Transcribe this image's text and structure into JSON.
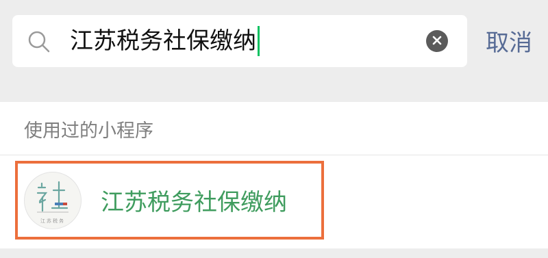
{
  "search": {
    "query": "江苏税务社保缴纳",
    "cancel_label": "取消"
  },
  "section": {
    "header": "使用过的小程序"
  },
  "results": [
    {
      "title": "江苏税务社保缴纳",
      "logo_text": "江苏税务"
    }
  ],
  "colors": {
    "caret": "#07c160",
    "cancel": "#576b95",
    "result_title": "#3f9c5e",
    "highlight_border": "#ec6f3c"
  },
  "icons": {
    "search": "search-icon",
    "clear": "clear-icon",
    "logo": "she-logo-icon"
  }
}
